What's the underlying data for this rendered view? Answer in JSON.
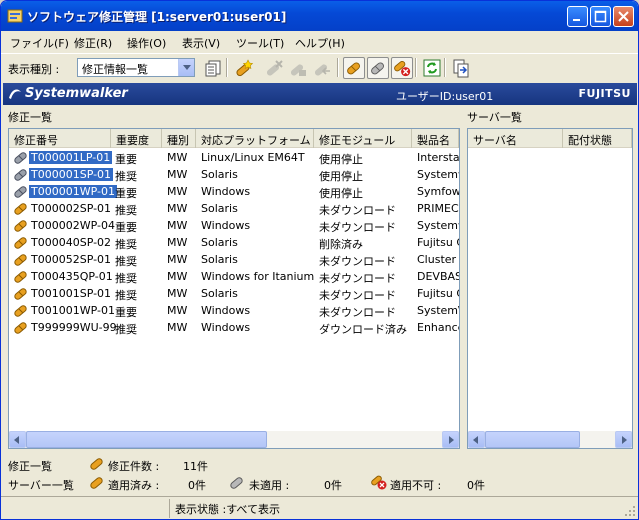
{
  "window": {
    "title": "ソフトウェア修正管理 [1:server01:user01]"
  },
  "menu": [
    "ファイル(F)",
    "修正(R)",
    "操作(O)",
    "表示(V)",
    "ツール(T)",
    "ヘルプ(H)"
  ],
  "toolbar": {
    "view_type_label": "表示種別 :",
    "view_type_value": "修正情報一覧"
  },
  "banner": {
    "logo": "Systemwalker",
    "user": "ユーザーID:user01",
    "brand": "FUJITSU"
  },
  "left_pane": {
    "label": "修正一覧",
    "columns": [
      "修正番号",
      "重要度",
      "種別",
      "対応プラットフォーム",
      "修正モジュール",
      "製品名"
    ],
    "rows": [
      {
        "id": "T000001LP-01",
        "importance": "重要",
        "type": "MW",
        "platform": "Linux/Linux EM64T",
        "module": "使用停止",
        "product": "Interstag",
        "icon": "gray-patch-icon",
        "selected": true
      },
      {
        "id": "T000001SP-01",
        "importance": "推奨",
        "type": "MW",
        "platform": "Solaris",
        "module": "使用停止",
        "product": "Systemw",
        "icon": "gray-patch-icon",
        "selected": true
      },
      {
        "id": "T000001WP-01",
        "importance": "重要",
        "type": "MW",
        "platform": "Windows",
        "module": "使用停止",
        "product": "Symfow",
        "icon": "gray-patch-icon",
        "selected": true
      },
      {
        "id": "T000002SP-01",
        "importance": "推奨",
        "type": "MW",
        "platform": "Solaris",
        "module": "未ダウンロード",
        "product": "PRIMEC",
        "icon": "orange-patch-icon",
        "selected": false
      },
      {
        "id": "T000002WP-04",
        "importance": "重要",
        "type": "MW",
        "platform": "Windows",
        "module": "未ダウンロード",
        "product": "Systemw",
        "icon": "orange-patch-icon",
        "selected": false
      },
      {
        "id": "T000040SP-02",
        "importance": "推奨",
        "type": "MW",
        "platform": "Solaris",
        "module": "削除済み",
        "product": "Fujitsu C",
        "icon": "orange-patch-icon",
        "selected": false
      },
      {
        "id": "T000052SP-01",
        "importance": "推奨",
        "type": "MW",
        "platform": "Solaris",
        "module": "未ダウンロード",
        "product": "Cluster",
        "icon": "orange-patch-icon",
        "selected": false
      },
      {
        "id": "T000435QP-01",
        "importance": "推奨",
        "type": "MW",
        "platform": "Windows for Itanium",
        "module": "未ダウンロード",
        "product": "DEVBAS",
        "icon": "orange-patch-icon",
        "selected": false
      },
      {
        "id": "T001001SP-01",
        "importance": "推奨",
        "type": "MW",
        "platform": "Solaris",
        "module": "未ダウンロード",
        "product": "Fujitsu C",
        "icon": "orange-patch-icon",
        "selected": false
      },
      {
        "id": "T001001WP-01",
        "importance": "重要",
        "type": "MW",
        "platform": "Windows",
        "module": "未ダウンロード",
        "product": "System\\",
        "icon": "orange-patch-icon",
        "selected": false
      },
      {
        "id": "T999999WU-99",
        "importance": "推奨",
        "type": "MW",
        "platform": "Windows",
        "module": "ダウンロード済み",
        "product": "Enhance",
        "icon": "orange-patch-icon",
        "selected": false
      }
    ]
  },
  "right_pane": {
    "label": "サーバ一覧",
    "columns": [
      "サーバ名",
      "配付状態"
    ]
  },
  "summary": {
    "patch_list_label": "修正一覧",
    "patch_count_label": "修正件数 :",
    "patch_count_value": "11件",
    "server_list_label": "サーバー一覧",
    "applied_label": "適用済み :",
    "applied_value": "0件",
    "unapplied_label": "未適用 :",
    "unapplied_value": "0件",
    "not_applicable_label": "適用不可 :",
    "not_applicable_value": "0件"
  },
  "statusbar": {
    "text": "表示状態 :すべて表示"
  },
  "colors": {
    "title_bar": "#0549d6",
    "banner": "#1f3f8f",
    "selection": "#316ac5",
    "patch_orange": "#e8a020"
  }
}
